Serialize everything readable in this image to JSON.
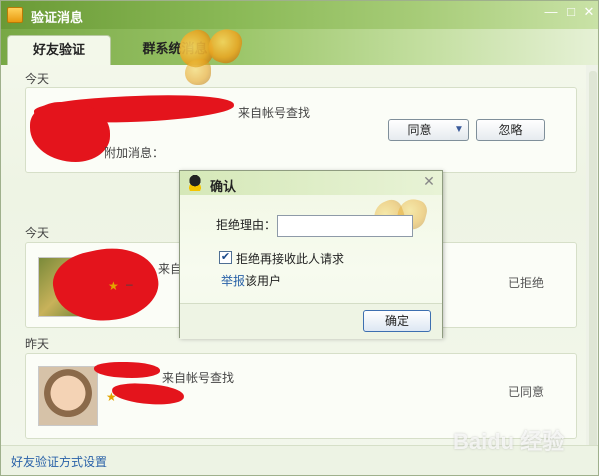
{
  "window": {
    "title": "验证消息",
    "controls": [
      "—",
      "□",
      "✕"
    ]
  },
  "tabs": [
    {
      "label": "好友验证"
    },
    {
      "label": "群系统消息"
    }
  ],
  "sections": [
    {
      "day": "今天"
    },
    {
      "day": "今天"
    },
    {
      "day": "昨天"
    }
  ],
  "cards": [
    {
      "source": "来自帐号查找",
      "extra": "附加消息：",
      "accept_label": "同意",
      "ignore_label": "忽略"
    },
    {
      "source": "来自",
      "status": "已拒绝"
    },
    {
      "source": "来自帐号查找",
      "status": "已同意"
    }
  ],
  "footer": {
    "settings_link": "好友验证方式设置",
    "watermark": "Baidu 经验"
  },
  "dialog": {
    "title": "确认",
    "reason_label": "拒绝理由：",
    "reason_value": "",
    "reject_checkbox_label": "拒绝再接收此人请求",
    "reject_checked": true,
    "report_link": "举报",
    "report_suffix": "该用户",
    "confirm_label": "确定",
    "close_glyph": "✕"
  },
  "colors": {
    "accent_green": "#8bba57",
    "link_blue": "#2a62a8",
    "redaction_red": "#e4141c"
  }
}
